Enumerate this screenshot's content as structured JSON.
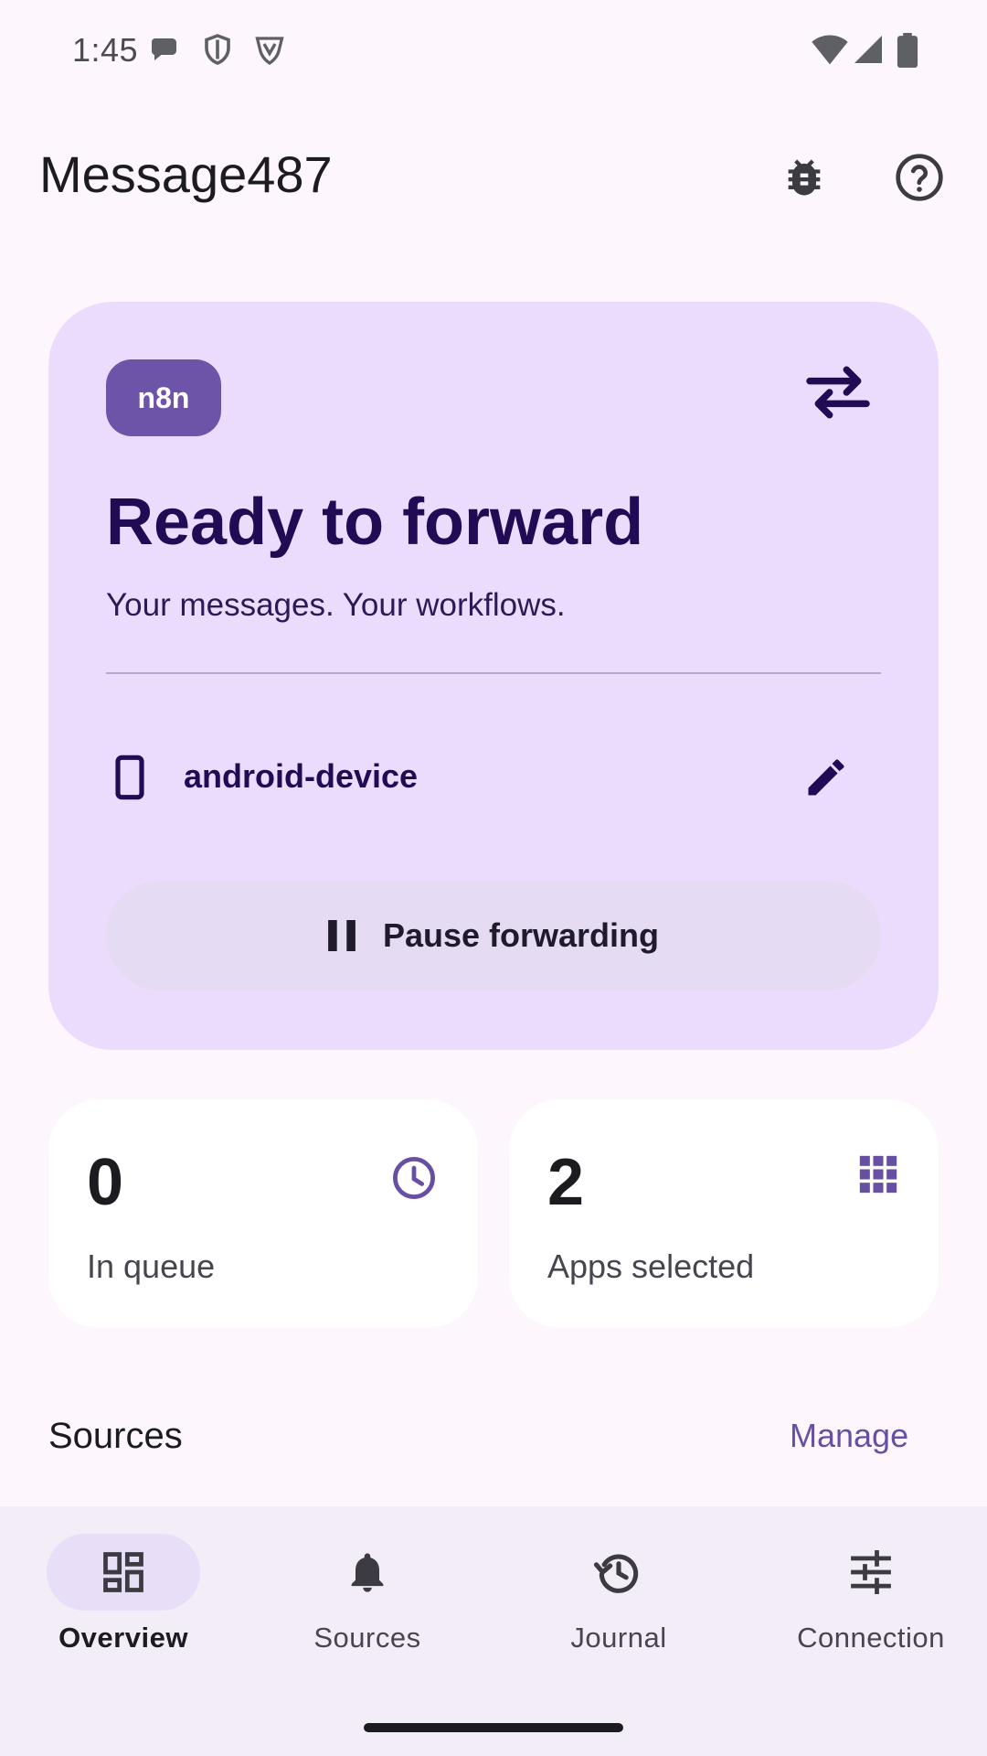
{
  "status_bar": {
    "time": "1:45",
    "left_icons": [
      "chat-bubble-icon",
      "shield-icon",
      "vpn-shield-icon"
    ],
    "right_icons": [
      "wifi-icon",
      "signal-icon",
      "battery-icon"
    ]
  },
  "app_bar": {
    "title": "Message487",
    "actions": [
      "bug-icon",
      "help-icon"
    ]
  },
  "hero": {
    "badge": "n8n",
    "title": "Ready to forward",
    "subtitle": "Your messages. Your workflows.",
    "device_name": "android-device",
    "pause_label": "Pause forwarding"
  },
  "stats": [
    {
      "value": "0",
      "label": "In queue",
      "icon": "clock-icon"
    },
    {
      "value": "2",
      "label": "Apps selected",
      "icon": "apps-grid-icon"
    }
  ],
  "sources": {
    "title": "Sources",
    "manage_label": "Manage"
  },
  "bottom_nav": {
    "items": [
      {
        "label": "Overview",
        "icon": "dashboard-icon",
        "active": true
      },
      {
        "label": "Sources",
        "icon": "bell-icon",
        "active": false
      },
      {
        "label": "Journal",
        "icon": "history-icon",
        "active": false
      },
      {
        "label": "Connection",
        "icon": "tune-icon",
        "active": false
      }
    ]
  },
  "colors": {
    "background": "#fdf7fd",
    "hero_card": "#ebdcfe",
    "badge": "#6d54a8",
    "hero_text": "#220b55",
    "accent": "#6750a4",
    "nav_background": "#f3edf7",
    "nav_active_pill": "#e8def8"
  }
}
